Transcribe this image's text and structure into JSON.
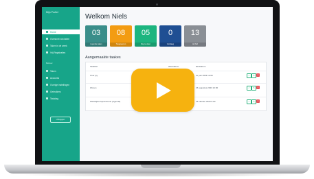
{
  "colors": {
    "sidebar": "#17a589",
    "stat_teal": "#3a8e8a",
    "stat_orange": "#f39c12",
    "stat_green": "#1cb57f",
    "stat_blue": "#1f4f93",
    "stat_gray": "#8a8f95",
    "play_button": "#f6b20f"
  },
  "sidebar": {
    "brand": "Mijn Profiel",
    "items": [
      {
        "label": "Home",
        "icon": "home-icon",
        "active": true
      },
      {
        "label": "Overzicht van taken",
        "icon": "list-icon",
        "active": false
      },
      {
        "label": "Taken in de week",
        "icon": "calendar-icon",
        "active": false
      },
      {
        "label": "Vrij Registraties",
        "icon": "clock-icon",
        "active": false
      }
    ],
    "section_label": "Beheer",
    "admin_items": [
      {
        "label": "Taken",
        "icon": "task-icon"
      },
      {
        "label": "Accounts",
        "icon": "user-icon"
      },
      {
        "label": "Overige instellingen",
        "icon": "gear-icon"
      },
      {
        "label": "Gebruikers",
        "icon": "users-icon"
      },
      {
        "label": "Taskdag",
        "icon": "flag-icon"
      }
    ],
    "logout_label": "Uitloggen"
  },
  "main": {
    "title": "Welkom Niels",
    "stats": [
      {
        "value": "03",
        "caption": "Lopende taken",
        "color_key": "stat_teal"
      },
      {
        "value": "08",
        "caption": "Toegewezen",
        "color_key": "stat_orange"
      },
      {
        "value": "05",
        "caption": "Nog te doen",
        "color_key": "stat_green"
      },
      {
        "value": "0",
        "caption": "Vandaag",
        "color_key": "stat_blue"
      },
      {
        "value": "13",
        "caption": "Archief",
        "color_key": "stat_gray"
      }
    ],
    "section_title": "Aangemaakte taakes",
    "table": {
      "headers": [
        "Taaktitel",
        "Werkdatum",
        "Einddatum",
        ""
      ],
      "rows": [
        {
          "title": "Over joy",
          "date1": "",
          "date2": "1e juni 2023 12:00"
        },
        {
          "title": "Wonen",
          "date1": "",
          "date2": "15 augustus 2023 12:00"
        },
        {
          "title": "Wekelijkse bijeenkomst (Agenda)",
          "date1": "",
          "date2": "15 oktober 2023 9:00"
        }
      ]
    }
  },
  "overlay": {
    "icon": "play-icon"
  }
}
